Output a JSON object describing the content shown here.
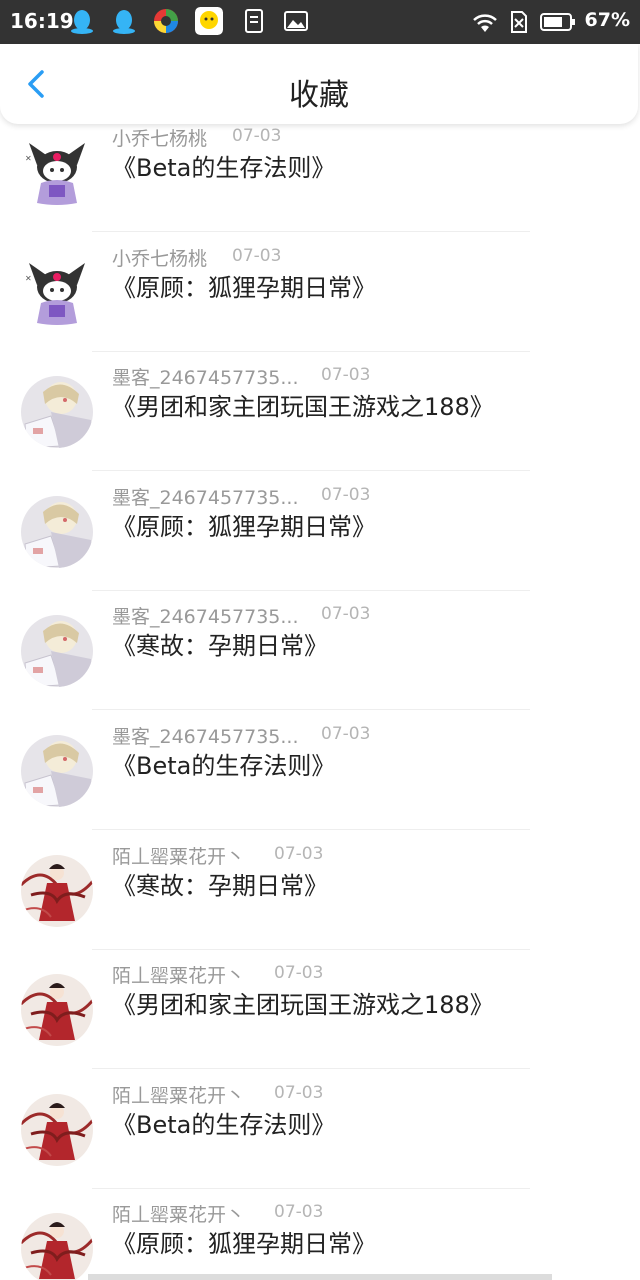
{
  "status_bar": {
    "time": "16:19",
    "battery_percent": "67%"
  },
  "header": {
    "title": "收藏"
  },
  "items": [
    {
      "user": "小乔七杨桃",
      "date": "07-03",
      "book": "《Beta的生存法则》",
      "avatar": "kuromi"
    },
    {
      "user": "小乔七杨桃",
      "date": "07-03",
      "book": "《原顾：狐狸孕期日常》",
      "avatar": "kuromi"
    },
    {
      "user": "墨客_2467457735...",
      "date": "07-03",
      "book": "《男团和家主团玩国王游戏之188》",
      "avatar": "anime-sketch"
    },
    {
      "user": "墨客_2467457735...",
      "date": "07-03",
      "book": "《原顾：狐狸孕期日常》",
      "avatar": "anime-sketch"
    },
    {
      "user": "墨客_2467457735...",
      "date": "07-03",
      "book": "《寒故：孕期日常》",
      "avatar": "anime-sketch"
    },
    {
      "user": "墨客_2467457735...",
      "date": "07-03",
      "book": "《Beta的生存法则》",
      "avatar": "anime-sketch"
    },
    {
      "user": "陌丄罂粟花开丶",
      "date": "07-03",
      "book": "《寒故：孕期日常》",
      "avatar": "red-dancer"
    },
    {
      "user": "陌丄罂粟花开丶",
      "date": "07-03",
      "book": "《男团和家主团玩国王游戏之188》",
      "avatar": "red-dancer"
    },
    {
      "user": "陌丄罂粟花开丶",
      "date": "07-03",
      "book": "《Beta的生存法则》",
      "avatar": "red-dancer"
    },
    {
      "user": "陌丄罂粟花开丶",
      "date": "07-03",
      "book": "《原顾：狐狸孕期日常》",
      "avatar": "red-dancer"
    }
  ],
  "colors": {
    "accent": "#2a9df4",
    "status_bar": "#333333"
  }
}
